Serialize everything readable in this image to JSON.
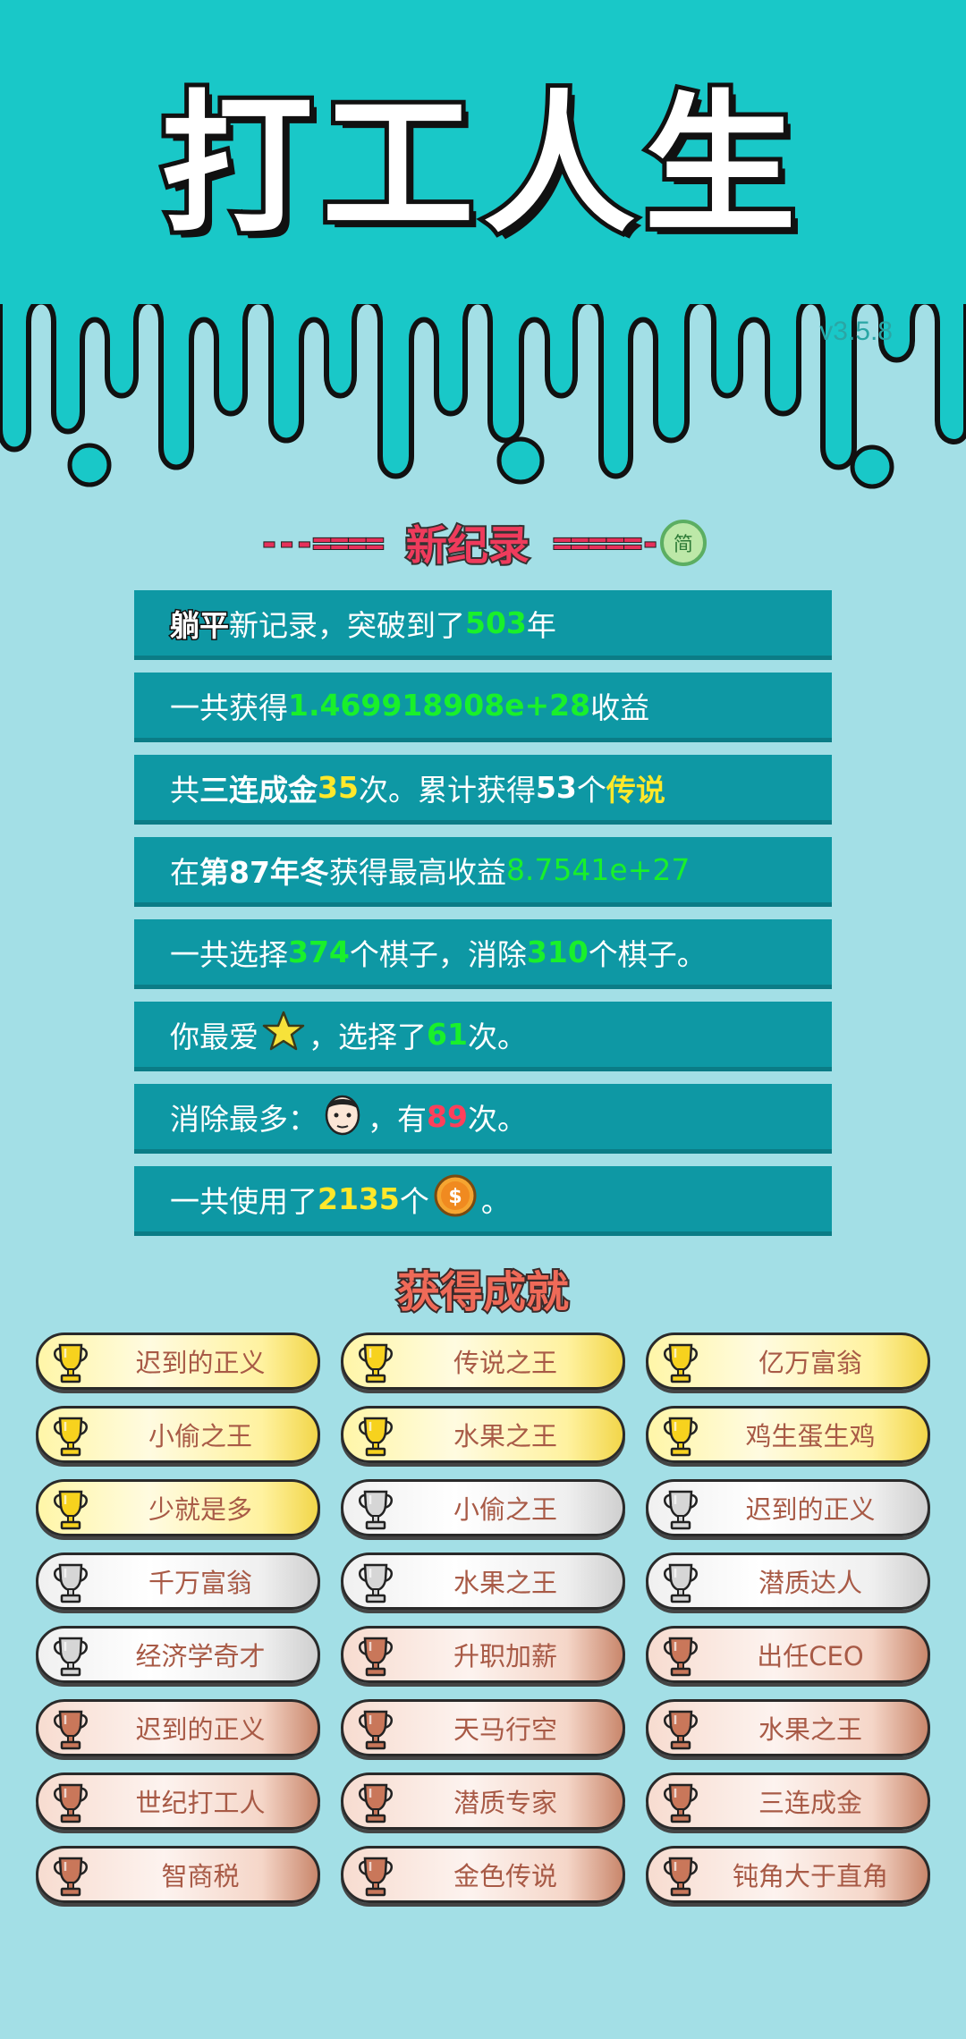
{
  "app": {
    "title": "打工人生",
    "version": "v3.5.8"
  },
  "record": {
    "heading": "新纪录",
    "left_dashes": "---====",
    "right_dashes": "=====-",
    "lang_button": "简",
    "rows": [
      {
        "parts": [
          {
            "t": "躺平",
            "s": "tang"
          },
          {
            "t": "新记录，突破到了"
          },
          {
            "t": "503",
            "s": "g"
          },
          {
            "t": "年"
          }
        ]
      },
      {
        "parts": [
          {
            "t": "一共获得"
          },
          {
            "t": "1.469918908e+28",
            "s": "g"
          },
          {
            "t": "收益"
          }
        ]
      },
      {
        "parts": [
          {
            "t": "共"
          },
          {
            "t": "三连成金",
            "s": "b"
          },
          {
            "t": "35",
            "s": "y"
          },
          {
            "t": "次。累计获得"
          },
          {
            "t": "53",
            "s": "b"
          },
          {
            "t": "个"
          },
          {
            "t": "传说",
            "s": "y"
          }
        ]
      },
      {
        "parts": [
          {
            "t": "在 "
          },
          {
            "t": "第87年冬",
            "s": "b"
          },
          {
            "t": " 获得最高收益"
          },
          {
            "t": "8.7541e+27",
            "s": "gl"
          }
        ]
      },
      {
        "parts": [
          {
            "t": "一共选择"
          },
          {
            "t": "374",
            "s": "g"
          },
          {
            "t": "个棋子，消除"
          },
          {
            "t": "310",
            "s": "g"
          },
          {
            "t": "个棋子。"
          }
        ]
      },
      {
        "parts": [
          {
            "t": "你最爱"
          },
          {
            "icon": "star-icon"
          },
          {
            "t": "，选择了"
          },
          {
            "t": "61",
            "s": "g"
          },
          {
            "t": "次。"
          }
        ]
      },
      {
        "parts": [
          {
            "t": "消除最多："
          },
          {
            "icon": "face-icon"
          },
          {
            "t": "，有"
          },
          {
            "t": "89",
            "s": "r"
          },
          {
            "t": "次。"
          }
        ]
      },
      {
        "parts": [
          {
            "t": "一共使用了"
          },
          {
            "t": "2135",
            "s": "y"
          },
          {
            "t": "个"
          },
          {
            "icon": "coin-icon"
          },
          {
            "t": "。"
          }
        ]
      }
    ]
  },
  "achievements": {
    "heading": "获得成就",
    "items": [
      {
        "name": "迟到的正义",
        "tier": "gold"
      },
      {
        "name": "传说之王",
        "tier": "gold"
      },
      {
        "name": "亿万富翁",
        "tier": "gold"
      },
      {
        "name": "小偷之王",
        "tier": "gold"
      },
      {
        "name": "水果之王",
        "tier": "gold"
      },
      {
        "name": "鸡生蛋生鸡",
        "tier": "gold"
      },
      {
        "name": "少就是多",
        "tier": "gold"
      },
      {
        "name": "小偷之王",
        "tier": "silver"
      },
      {
        "name": "迟到的正义",
        "tier": "silver"
      },
      {
        "name": "千万富翁",
        "tier": "silver"
      },
      {
        "name": "水果之王",
        "tier": "silver"
      },
      {
        "name": "潜质达人",
        "tier": "silver"
      },
      {
        "name": "经济学奇才",
        "tier": "silver"
      },
      {
        "name": "升职加薪",
        "tier": "bronze"
      },
      {
        "name": "出任CEO",
        "tier": "bronze"
      },
      {
        "name": "迟到的正义",
        "tier": "bronze"
      },
      {
        "name": "天马行空",
        "tier": "bronze"
      },
      {
        "name": "水果之王",
        "tier": "bronze"
      },
      {
        "name": "世纪打工人",
        "tier": "bronze"
      },
      {
        "name": "潜质专家",
        "tier": "bronze"
      },
      {
        "name": "三连成金",
        "tier": "bronze"
      },
      {
        "name": "智商税",
        "tier": "bronze"
      },
      {
        "name": "金色传说",
        "tier": "bronze"
      },
      {
        "name": "钝角大于直角",
        "tier": "bronze"
      }
    ]
  },
  "colors": {
    "header_bg": "#19c8c8",
    "page_bg": "#a3dfe6",
    "row_bg": "#0e98a4",
    "green": "#19f02b",
    "yellow": "#ffe82a",
    "red": "#ff3f5a"
  }
}
